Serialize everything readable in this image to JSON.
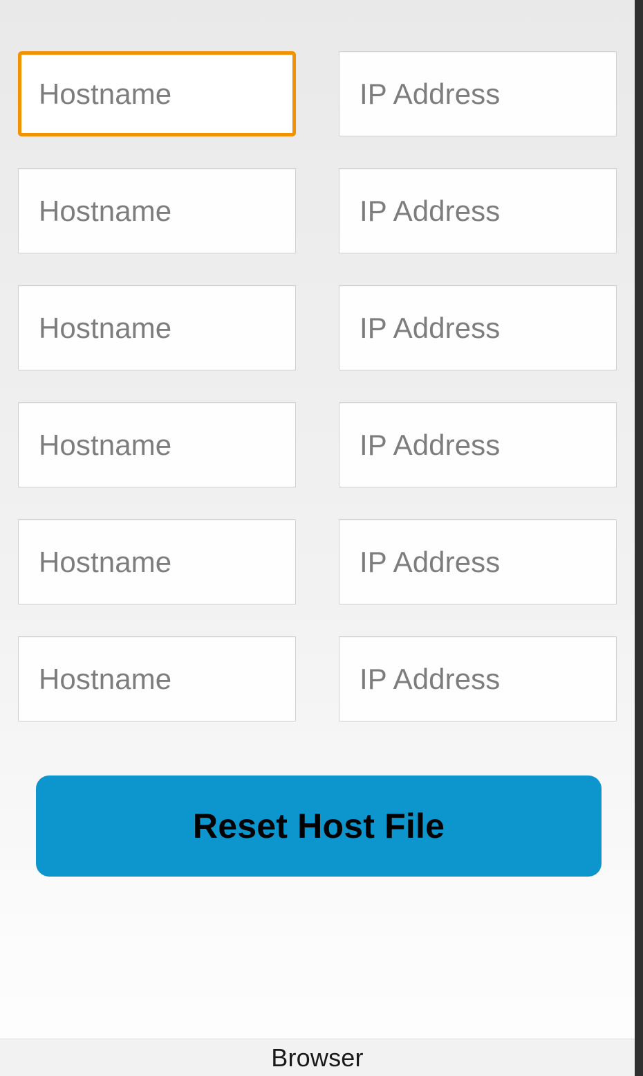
{
  "app": {
    "background_top_color": "#e9e9e9",
    "background_bottom_color": "#fdfdfd",
    "accent_focus_color": "#f39200",
    "button_color": "#0d96ce",
    "edge_strip_color": "#303030"
  },
  "form": {
    "rows": [
      {
        "hostname": {
          "placeholder": "Hostname",
          "value": "",
          "focused": true
        },
        "ip": {
          "placeholder": "IP Address",
          "value": "",
          "focused": false
        }
      },
      {
        "hostname": {
          "placeholder": "Hostname",
          "value": "",
          "focused": false
        },
        "ip": {
          "placeholder": "IP Address",
          "value": "",
          "focused": false
        }
      },
      {
        "hostname": {
          "placeholder": "Hostname",
          "value": "",
          "focused": false
        },
        "ip": {
          "placeholder": "IP Address",
          "value": "",
          "focused": false
        }
      },
      {
        "hostname": {
          "placeholder": "Hostname",
          "value": "",
          "focused": false
        },
        "ip": {
          "placeholder": "IP Address",
          "value": "",
          "focused": false
        }
      },
      {
        "hostname": {
          "placeholder": "Hostname",
          "value": "",
          "focused": false
        },
        "ip": {
          "placeholder": "IP Address",
          "value": "",
          "focused": false
        }
      },
      {
        "hostname": {
          "placeholder": "Hostname",
          "value": "",
          "focused": false
        },
        "ip": {
          "placeholder": "IP Address",
          "value": "",
          "focused": false
        }
      }
    ]
  },
  "actions": {
    "reset_label": "Reset Host File"
  },
  "bottom_bar": {
    "label": "Browser"
  }
}
